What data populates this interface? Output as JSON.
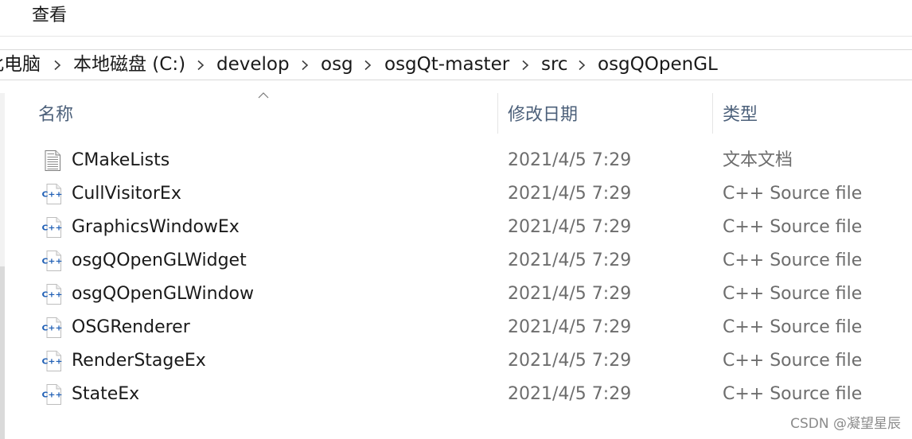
{
  "ribbon": {
    "tabs": [
      {
        "label": "查看"
      }
    ]
  },
  "address_bar": {
    "breadcrumb": [
      "此电脑",
      "本地磁盘 (C:)",
      "develop",
      "osg",
      "osgQt-master",
      "src",
      "osgQOpenGL"
    ],
    "separator_icon": "chevron-right-icon"
  },
  "file_list": {
    "columns": [
      {
        "label": "名称"
      },
      {
        "label": "修改日期"
      },
      {
        "label": "类型"
      }
    ],
    "sort_indicator_icon": "chevron-up-icon",
    "cpp_icon_label": "C++",
    "rows": [
      {
        "name": "CMakeLists",
        "modified": "2021/4/5 7:29",
        "type": "文本文档",
        "icon": "text-document-icon"
      },
      {
        "name": "CullVisitorEx",
        "modified": "2021/4/5 7:29",
        "type": "C++ Source file",
        "icon": "cpp-source-icon"
      },
      {
        "name": "GraphicsWindowEx",
        "modified": "2021/4/5 7:29",
        "type": "C++ Source file",
        "icon": "cpp-source-icon"
      },
      {
        "name": "osgQOpenGLWidget",
        "modified": "2021/4/5 7:29",
        "type": "C++ Source file",
        "icon": "cpp-source-icon"
      },
      {
        "name": "osgQOpenGLWindow",
        "modified": "2021/4/5 7:29",
        "type": "C++ Source file",
        "icon": "cpp-source-icon"
      },
      {
        "name": "OSGRenderer",
        "modified": "2021/4/5 7:29",
        "type": "C++ Source file",
        "icon": "cpp-source-icon"
      },
      {
        "name": "RenderStageEx",
        "modified": "2021/4/5 7:29",
        "type": "C++ Source file",
        "icon": "cpp-source-icon"
      },
      {
        "name": "StateEx",
        "modified": "2021/4/5 7:29",
        "type": "C++ Source file",
        "icon": "cpp-source-icon"
      }
    ]
  },
  "watermark": "CSDN @凝望星辰",
  "colors": {
    "background": "#ffffff",
    "text": "#1a1a1a",
    "header_text": "#4c607a",
    "secondary_text": "#6d6d6d",
    "divider": "#e5e5e5",
    "cpp_icon": "#1f5fb5",
    "watermark": "#8a8a8a"
  }
}
